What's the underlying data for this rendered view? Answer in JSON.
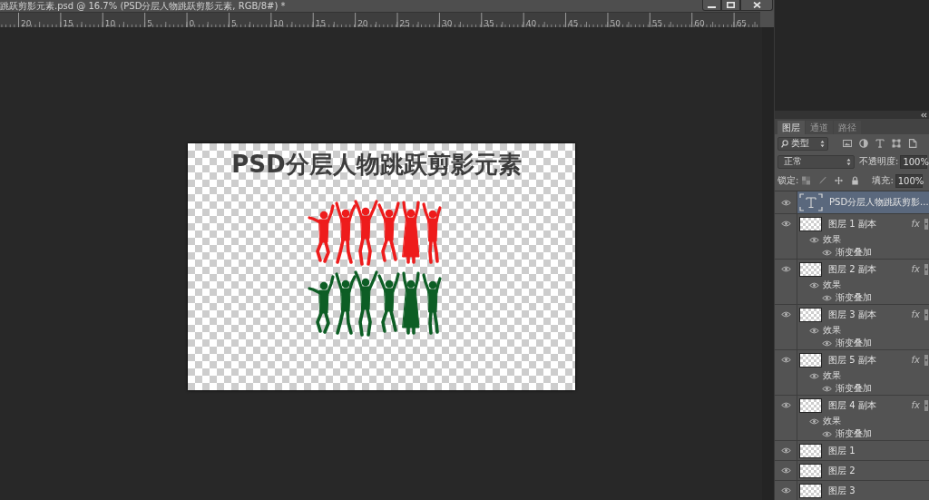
{
  "window": {
    "title": "跳跃剪影元素.psd @ 16.7% (PSD分层人物跳跃剪影元素, RGB/8#) *"
  },
  "ruler": {
    "labels": [
      "20",
      "15",
      "10",
      "5",
      "0",
      "5",
      "10",
      "15",
      "20",
      "25",
      "30",
      "35",
      "40",
      "45",
      "50",
      "55",
      "60",
      "65"
    ]
  },
  "canvas": {
    "heading": "PSD分层人物跳跃剪影元素",
    "silhouette_rows": [
      {
        "color": "#ee1c1c"
      },
      {
        "color": "#0d5e25"
      }
    ]
  },
  "layers_panel": {
    "tabs": [
      {
        "label": "图层",
        "selected": true
      },
      {
        "label": "通道",
        "selected": false
      },
      {
        "label": "路径",
        "selected": false
      }
    ],
    "filter": {
      "value": "类型"
    },
    "blend_mode": {
      "value": "正常"
    },
    "opacity": {
      "label": "不透明度:",
      "value": "100%"
    },
    "lock": {
      "label": "锁定:"
    },
    "fill": {
      "label": "填充:",
      "value": "100%"
    },
    "layers": [
      {
        "kind": "text",
        "name": "PSD分层人物跳跃剪影...",
        "visible": true,
        "selected": true
      },
      {
        "kind": "pixel",
        "name": "图层 1 副本",
        "visible": true,
        "selected": false,
        "badge": "fx",
        "expanded": true,
        "effects": [
          {
            "label": "效果",
            "visible": true,
            "children": [
              {
                "label": "渐变叠加",
                "visible": true
              }
            ]
          }
        ]
      },
      {
        "kind": "pixel",
        "name": "图层 2 副本",
        "visible": true,
        "selected": false,
        "badge": "fx",
        "expanded": true,
        "effects": [
          {
            "label": "效果",
            "visible": true,
            "children": [
              {
                "label": "渐变叠加",
                "visible": true
              }
            ]
          }
        ]
      },
      {
        "kind": "pixel",
        "name": "图层 3 副本",
        "visible": true,
        "selected": false,
        "badge": "fx",
        "expanded": true,
        "effects": [
          {
            "label": "效果",
            "visible": true,
            "children": [
              {
                "label": "渐变叠加",
                "visible": true
              }
            ]
          }
        ]
      },
      {
        "kind": "pixel",
        "name": "图层 5 副本",
        "visible": true,
        "selected": false,
        "badge": "fx",
        "expanded": true,
        "effects": [
          {
            "label": "效果",
            "visible": true,
            "children": [
              {
                "label": "渐变叠加",
                "visible": true
              }
            ]
          }
        ]
      },
      {
        "kind": "pixel",
        "name": "图层 4 副本",
        "visible": true,
        "selected": false,
        "badge": "fx",
        "expanded": true,
        "effects": [
          {
            "label": "效果",
            "visible": true,
            "children": [
              {
                "label": "渐变叠加",
                "visible": true
              }
            ]
          }
        ]
      },
      {
        "kind": "pixel",
        "name": "图层 1",
        "visible": true,
        "selected": false
      },
      {
        "kind": "pixel",
        "name": "图层 2",
        "visible": true,
        "selected": false
      },
      {
        "kind": "pixel",
        "name": "图层 3",
        "visible": true,
        "selected": false
      }
    ]
  }
}
